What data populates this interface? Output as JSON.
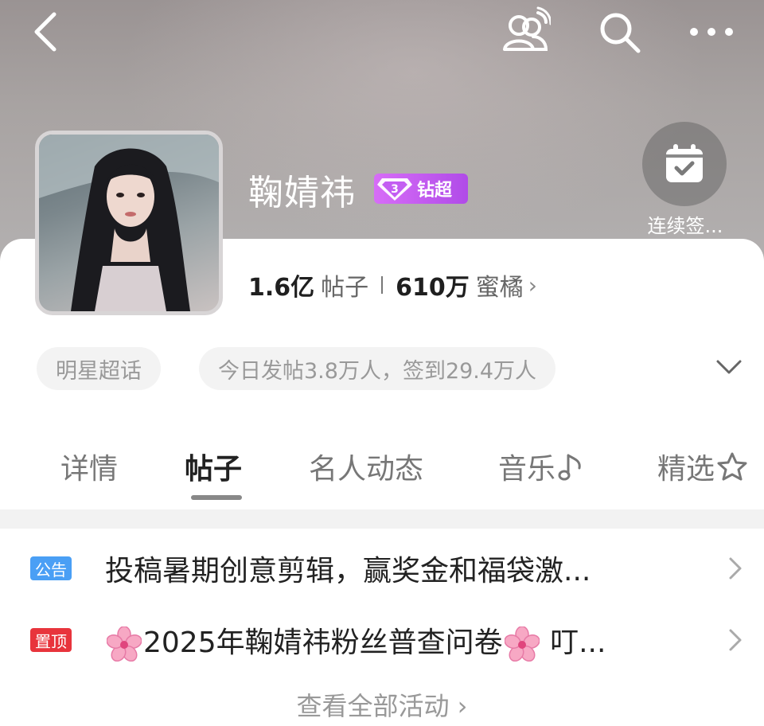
{
  "header": {
    "back_icon": "chevron-left-icon",
    "fans_icon": "people-wave-icon",
    "search_icon": "search-icon",
    "more_icon": "more-dots-icon"
  },
  "checkin": {
    "label": "连续签..."
  },
  "profile": {
    "name": "鞠婧祎",
    "badge_label": "钻超",
    "badge_level": "3",
    "stats": {
      "posts_value": "1.6亿",
      "posts_label": "帖子",
      "fans_value": "610万",
      "fans_label": "蜜橘",
      "chevron": "›"
    },
    "chips": {
      "category": "明星超话",
      "activity": "今日发帖3.8万人，签到29.4万人"
    }
  },
  "tabs": [
    {
      "label": "详情"
    },
    {
      "label": "帖子"
    },
    {
      "label": "名人动态"
    },
    {
      "label": "音乐"
    },
    {
      "label": "精选"
    }
  ],
  "notices": [
    {
      "tag": "公告",
      "tag_color": "#4a9ff5",
      "text": "投稿暑期创意剪辑，赢奖金和福袋激..."
    },
    {
      "tag": "置顶",
      "tag_color": "#e8343c",
      "text_after_flower": "2025年鞠婧祎粉丝普查问卷",
      "text_tail": " 叮..."
    }
  ],
  "view_all": "查看全部活动 ›",
  "colors": {
    "badge": "#c25af0",
    "notice_tag": "#4a9ff5",
    "pin_tag": "#e8343c"
  }
}
